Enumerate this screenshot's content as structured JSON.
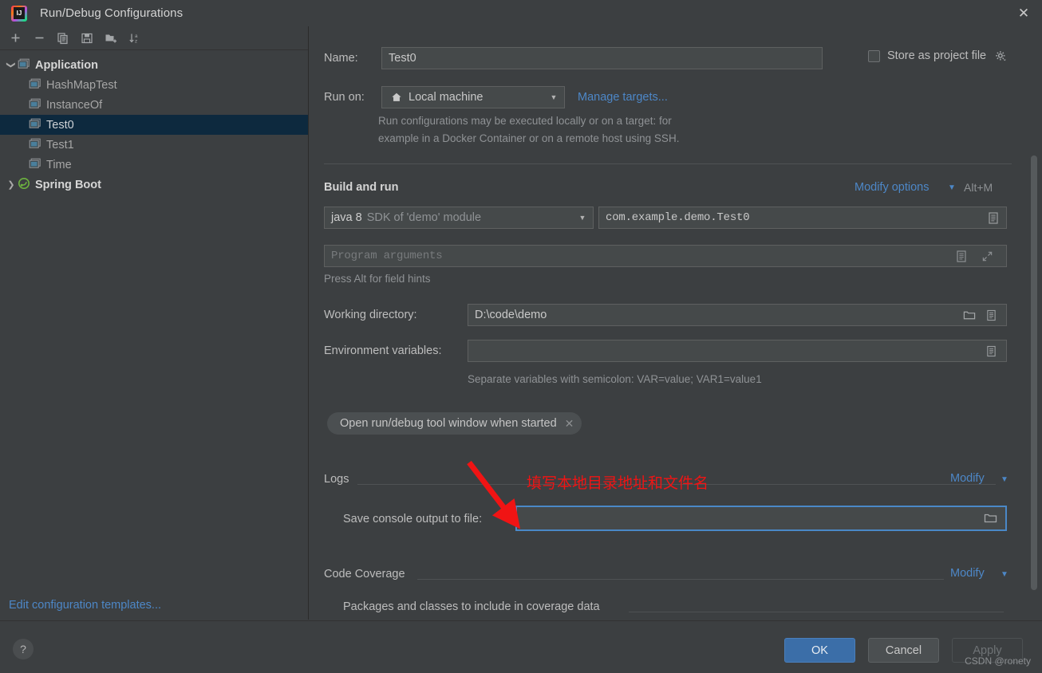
{
  "window": {
    "title": "Run/Debug Configurations",
    "close_label": "✕",
    "logo_name": "intellij-idea-logo"
  },
  "left_panel": {
    "toolbar": [
      {
        "name": "add-configuration-button",
        "icon": "plus-icon",
        "tooltip": "Add New Configuration"
      },
      {
        "name": "remove-configuration-button",
        "icon": "minus-icon",
        "tooltip": "Remove Configuration"
      },
      {
        "name": "copy-configuration-button",
        "icon": "copy-icon",
        "tooltip": "Copy Configuration"
      },
      {
        "name": "save-configuration-button",
        "icon": "save-icon",
        "tooltip": "Save Configuration"
      },
      {
        "name": "new-folder-button",
        "icon": "new-folder-icon",
        "tooltip": "Create New Folder"
      },
      {
        "name": "sort-button",
        "icon": "sort-alphabetical-icon",
        "tooltip": "Sort Configurations"
      }
    ],
    "tree": [
      {
        "label": "Application",
        "level": 0,
        "expanded": true,
        "bold": true,
        "selected": false,
        "icon": "application-icon"
      },
      {
        "label": "HashMapTest",
        "level": 1,
        "expanded": null,
        "bold": false,
        "selected": false,
        "icon": "application-icon"
      },
      {
        "label": "InstanceOf",
        "level": 1,
        "expanded": null,
        "bold": false,
        "selected": false,
        "icon": "application-icon"
      },
      {
        "label": "Test0",
        "level": 1,
        "expanded": null,
        "bold": false,
        "selected": true,
        "icon": "application-icon"
      },
      {
        "label": "Test1",
        "level": 1,
        "expanded": null,
        "bold": false,
        "selected": false,
        "icon": "application-icon"
      },
      {
        "label": "Time",
        "level": 1,
        "expanded": null,
        "bold": false,
        "selected": false,
        "icon": "application-icon"
      },
      {
        "label": "Spring Boot",
        "level": 0,
        "expanded": false,
        "bold": true,
        "selected": false,
        "icon": "spring-boot-icon"
      }
    ],
    "edit_templates_link": "Edit configuration templates..."
  },
  "form": {
    "name_label": "Name:",
    "name_value": "Test0",
    "store_as_project_file_label": "Store as project file",
    "store_as_project_file_checked": false,
    "run_on_label": "Run on:",
    "run_on_value": "Local machine",
    "manage_targets_link": "Manage targets...",
    "run_on_description_line1": "Run configurations may be executed locally or on a target: for",
    "run_on_description_line2": "example in a Docker Container or on a remote host using SSH.",
    "build_and_run_title": "Build and run",
    "modify_options_link": "Modify options",
    "modify_options_shortcut": "Alt+M",
    "jdk_value_bold": "java 8",
    "jdk_value_rest": "SDK of 'demo' module",
    "main_class_value": "com.example.demo.Test0",
    "program_arguments_placeholder": "Program arguments",
    "field_hints_text": "Press Alt for field hints",
    "working_directory_label": "Working directory:",
    "working_directory_value": "D:\\code\\demo",
    "environment_variables_label": "Environment variables:",
    "environment_variables_value": "",
    "environment_variables_hint": "Separate variables with semicolon: VAR=value; VAR1=value1",
    "chip_label": "Open run/debug tool window when started",
    "chip_close": "✕",
    "logs_title": "Logs",
    "logs_modify_link": "Modify",
    "save_console_output_label": "Save console output to file:",
    "save_console_output_value": "",
    "code_coverage_title": "Code Coverage",
    "code_coverage_modify_link": "Modify",
    "coverage_packages_label": "Packages and classes to include in coverage data"
  },
  "footer": {
    "help_label": "?",
    "ok_label": "OK",
    "cancel_label": "Cancel",
    "apply_label": "Apply"
  },
  "annotation": {
    "chinese_note": "填写本地目录地址和文件名",
    "arrow_color": "#f01414",
    "watermark": "CSDN @ronety"
  },
  "colors": {
    "background": "#3c3f41",
    "selection": "#0d293e",
    "link": "#4d87c7",
    "focus_border": "#4a88c7",
    "primary_button": "#3b6ea8",
    "annotation_red": "#f01414"
  }
}
